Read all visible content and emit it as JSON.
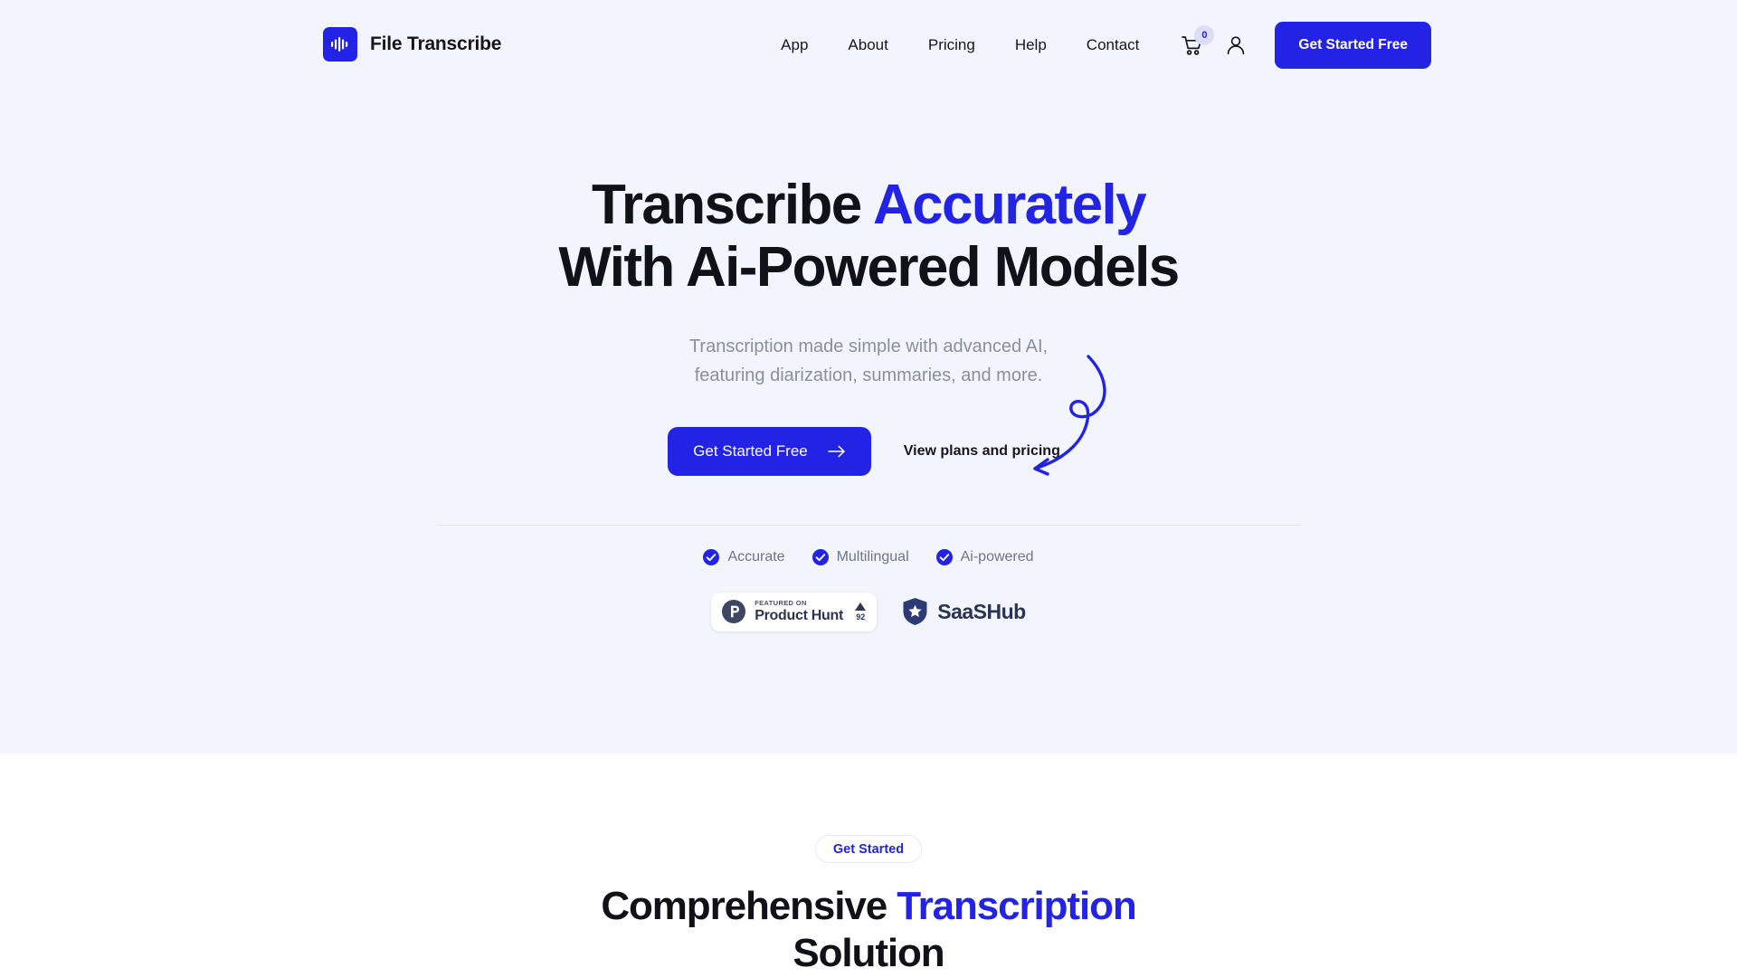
{
  "brand": {
    "name": "File Transcribe",
    "logo_icon": "audio-waveform-icon",
    "logo_color": "#2323e6"
  },
  "header": {
    "nav": [
      {
        "label": "App"
      },
      {
        "label": "About"
      },
      {
        "label": "Pricing"
      },
      {
        "label": "Help"
      },
      {
        "label": "Contact"
      }
    ],
    "cart": {
      "icon": "shopping-cart-icon",
      "badge_count": "0"
    },
    "account": {
      "icon": "user-account-icon"
    },
    "cta_label": "Get Started Free"
  },
  "hero": {
    "headline_line1_plain": "Transcribe ",
    "headline_line1_accent": "Accurately",
    "headline_line2": "With Ai-Powered Models",
    "subhead_line1": "Transcription made simple with advanced AI,",
    "subhead_line2": "featuring diarization, summaries, and more.",
    "cta_primary_label": "Get Started Free",
    "cta_primary_icon": "arrow-right-icon",
    "cta_secondary_label": "View plans and pricing",
    "decoration_icon": "curly-arrow-icon",
    "accent_color": "#2323e6",
    "background_color": "#f3f5fe",
    "features": [
      {
        "label": "Accurate",
        "icon": "check-circle-icon"
      },
      {
        "label": "Multilingual",
        "icon": "check-circle-icon"
      },
      {
        "label": "Ai-powered",
        "icon": "check-circle-icon"
      }
    ],
    "badges": {
      "product_hunt": {
        "icon": "product-hunt-icon",
        "featured_label": "FEATURED ON",
        "name": "Product Hunt",
        "upvote_icon": "triangle-up-icon",
        "upvote_count": "92"
      },
      "saashub": {
        "icon": "saashub-shield-star-icon",
        "name": "SaaSHub"
      }
    }
  },
  "section2": {
    "pill_label": "Get Started",
    "title_plain1": "Comprehensive ",
    "title_accent": "Transcription",
    "title_plain2": "Solution"
  }
}
